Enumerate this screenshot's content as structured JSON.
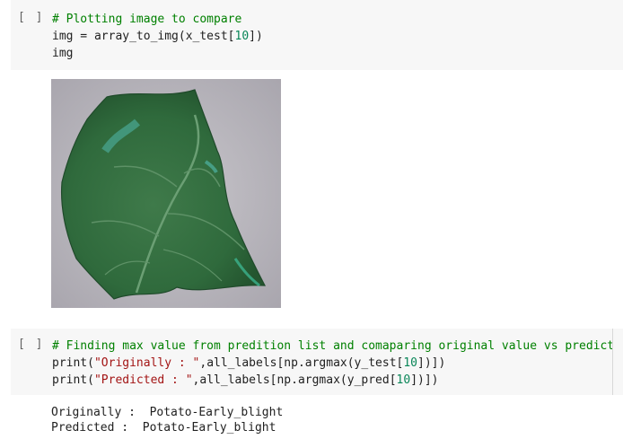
{
  "cell1": {
    "run_label": "[ ]",
    "lines": {
      "l1_comment": "# Plotting image to compare",
      "l2_pre": "img = array_to_img(x_test[",
      "l2_num": "10",
      "l2_post": "])",
      "l3": "img"
    }
  },
  "cell2": {
    "run_label": "[ ]",
    "lines": {
      "l1_comment": "# Finding max value from predition list and comaparing original value vs predicted",
      "l2_a": "print(",
      "l2_str": "\"Originally : \"",
      "l2_b": ",all_labels[np.argmax(y_test[",
      "l2_num": "10",
      "l2_c": "])])",
      "l3_a": "print(",
      "l3_str": "\"Predicted : \"",
      "l3_b": ",all_labels[np.argmax(y_pred[",
      "l3_num": "10",
      "l3_c": "])])"
    }
  },
  "output": {
    "line1": "Originally :  Potato-Early_blight",
    "line2": "Predicted :  Potato-Early_blight"
  },
  "colors": {
    "comment": "#008000",
    "number": "#098658",
    "string": "#a31515",
    "cell_bg": "#f7f7f7"
  }
}
